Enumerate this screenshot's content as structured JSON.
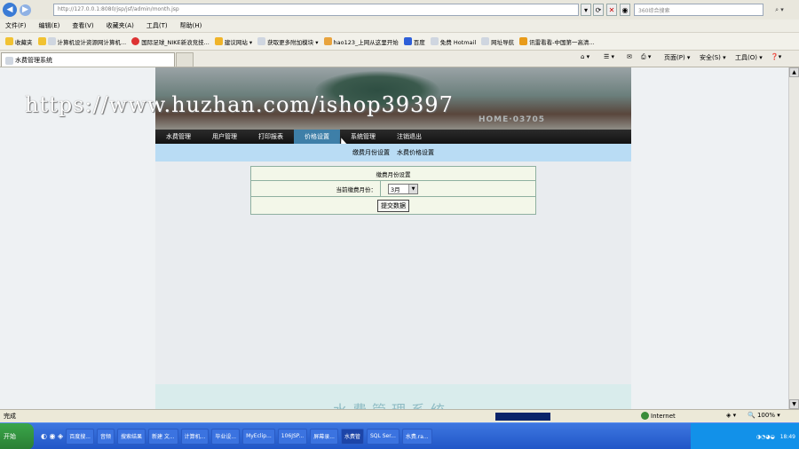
{
  "browser": {
    "url": "http://127.0.0.1:8080/jsp/jsf/admin/month.jsp",
    "search_placeholder": "360综合搜索",
    "menu": [
      "文件(F)",
      "编辑(E)",
      "查看(V)",
      "收藏夹(A)",
      "工具(T)",
      "帮助(H)"
    ],
    "favorites_label": "收藏夹",
    "favorites": [
      "计算机设计资源网计算机...",
      "国际足球_NIKE新浪竞技...",
      "建议网站 ▾",
      "获取更多附加模块 ▾",
      "hao123_上网从这里开始",
      "百度",
      "免费 Hotmail",
      "网址导航",
      "讯雷看看-中国第一高清..."
    ],
    "tab_title": "水费管理系统",
    "commands": [
      "页面(P) ▾",
      "安全(S) ▾",
      "工具(O) ▾"
    ],
    "status_left": "完成",
    "zone": "Internet",
    "zoom": "100%"
  },
  "page": {
    "nav": [
      "水费管理",
      "用户管理",
      "打印报表",
      "价格设置",
      "系统管理",
      "注销退出"
    ],
    "active_nav": 3,
    "subnav": [
      "缴费月份设置",
      "水费价格设置"
    ],
    "panel": {
      "title": "缴费月份设置",
      "field_label": "当前缴费月份：",
      "field_value": "3月",
      "submit": "提交数据"
    },
    "banner_text": "HOME·03705",
    "footer_text": "水费管理系统"
  },
  "watermark": "https://www.huzhan.com/ishop39397",
  "taskbar": {
    "start": "开始",
    "items": [
      "百度搜...",
      "音频",
      "搜索结果",
      "新建 文...",
      "计算机...",
      "毕业设...",
      "MyEclip...",
      "106JSP...",
      "屏幕录...",
      "水费管",
      "SQL Ser...",
      "水费.ra..."
    ],
    "active_item": 9,
    "clock": "18:49"
  }
}
